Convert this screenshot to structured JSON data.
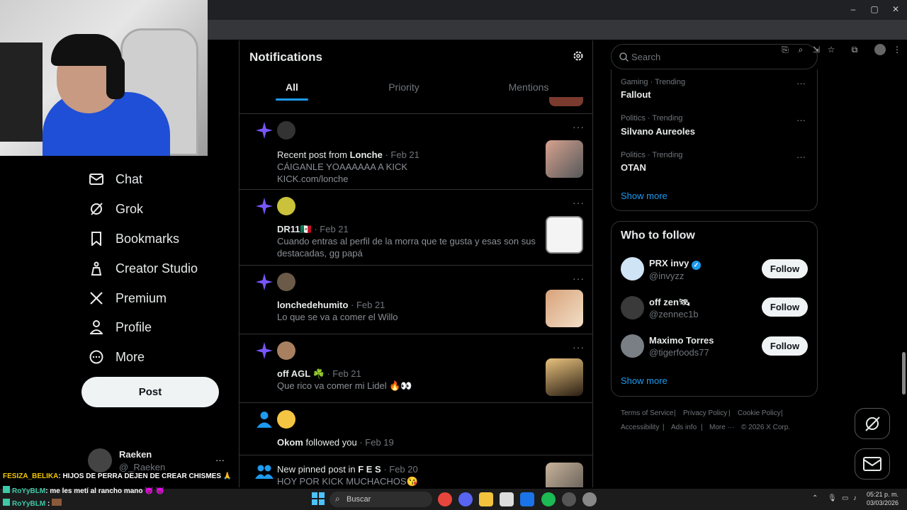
{
  "browser": {
    "window_controls": [
      "–",
      "▢",
      "✕"
    ]
  },
  "nav": {
    "items": [
      {
        "label": "Chat",
        "icon": "mail-icon"
      },
      {
        "label": "Grok",
        "icon": "grok-icon"
      },
      {
        "label": "Bookmarks",
        "icon": "bookmark-icon"
      },
      {
        "label": "Creator Studio",
        "icon": "creator-icon"
      },
      {
        "label": "Premium",
        "icon": "x-logo-icon"
      },
      {
        "label": "Profile",
        "icon": "person-icon"
      },
      {
        "label": "More",
        "icon": "more-circle-icon"
      }
    ],
    "post_label": "Post",
    "user_name": "Raeken",
    "user_handle": "@_Raeken",
    "user_more": "···"
  },
  "notifications": {
    "title": "Notifications",
    "tabs": [
      {
        "label": "All"
      },
      {
        "label": "Priority"
      },
      {
        "label": "Mentions"
      }
    ],
    "items": [
      {
        "pre": "Recent post from ",
        "name": "Lonche",
        "date": " · Feb 21",
        "line1": "CÁIGANLE YOAAAAAA A KICK",
        "line2": "KICK.com/lonche",
        "dots": "···"
      },
      {
        "name": "DR11🇲🇽",
        "date": " · Feb 21",
        "line1": "Cuando entras al perfil de la morra que te gusta y esas son sus",
        "line2": "destacadas, gg papá",
        "dots": "···"
      },
      {
        "name": "lonchedehumito",
        "date": " · Feb 21",
        "line1": "Lo que se va a comer el Willo",
        "dots": "···"
      },
      {
        "name": "off AGL ☘️",
        "date": " · Feb 21",
        "line1": "Que rico va comer mi Lidel 🔥👀",
        "dots": "···"
      },
      {
        "name": "Okom",
        "mid": " followed you",
        "date": " · Feb 19"
      },
      {
        "pre": "New pinned post in ",
        "name": "F E S",
        "date": " · Feb 20",
        "line1": "HOY POR KICK MUCHACHOS😘"
      }
    ]
  },
  "sidebar": {
    "search_placeholder": "Search",
    "trends": [
      {
        "meta": "Gaming · Trending",
        "name": "Fallout"
      },
      {
        "meta": "Politics · Trending",
        "name": "Silvano Aureoles"
      },
      {
        "meta": "Politics · Trending",
        "name": "OTAN"
      }
    ],
    "trends_show_more": "Show more",
    "who_to_follow_title": "Who to follow",
    "follow": [
      {
        "name": "PRX invy",
        "handle": "@invyzz",
        "button": "Follow",
        "verified": true
      },
      {
        "name": "off zen🛰",
        "handle": "@zennec1b",
        "button": "Follow"
      },
      {
        "name": "Maximo Torres",
        "handle": "@tigerfoods77",
        "button": "Follow"
      }
    ],
    "follow_show_more": "Show more",
    "footer": [
      "Terms of Service",
      "|",
      "Privacy Policy",
      "|",
      "Cookie Policy",
      "|",
      "Accessibility",
      "|",
      "Ads info",
      "|",
      "More ···",
      "© 2026 X Corp."
    ]
  },
  "chat_overlay": [
    {
      "user": "FESIZA_BELIKA",
      "text": ": HIJOS DE PERRA DEJEN DE CREAR CHISMES 🙏",
      "color": "#f2c700"
    },
    {
      "user": "RoYyBLM",
      "text": ": me les metí al rancho mano 👿 👿",
      "color": "#3ec9a7"
    },
    {
      "user": "RoYyBLM",
      "text": " : ",
      "color": "#3ec9a7"
    }
  ],
  "taskbar": {
    "search_label": "Buscar",
    "time": "05:21 p. m.",
    "date": "03/03/2026"
  },
  "colors": {
    "accent": "#1d9bf0",
    "star": "#7856ff",
    "background": "#000000"
  }
}
